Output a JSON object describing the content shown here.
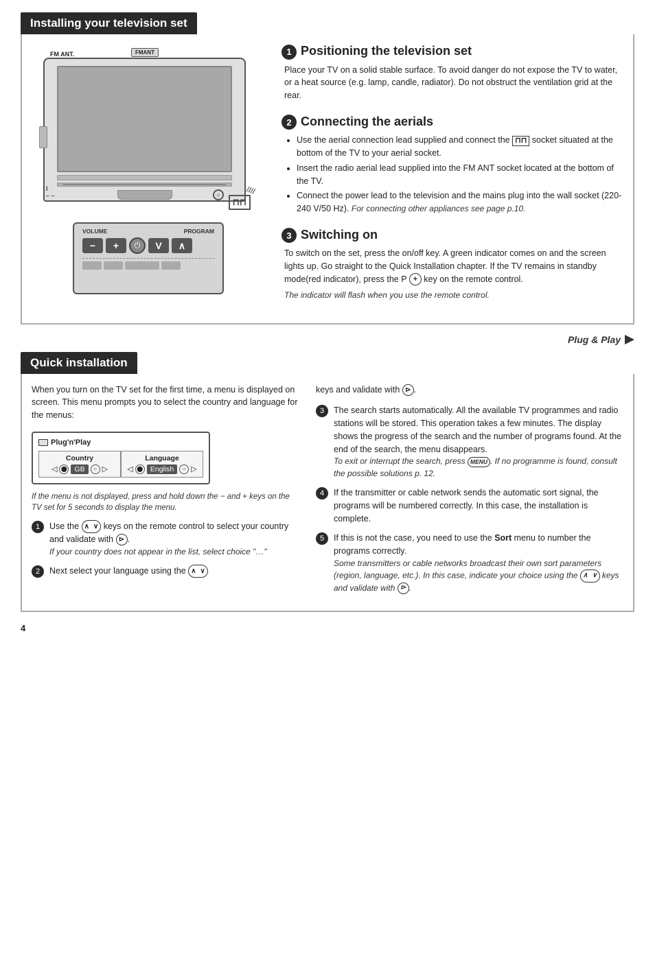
{
  "page": {
    "number": "4"
  },
  "top_section": {
    "header": "Installing your television set",
    "steps": [
      {
        "number": "❶",
        "title": "Positioning the television set",
        "body": "Place your TV on a solid stable surface.  To avoid danger do not expose the TV to water, or a heat source (e.g. lamp, candle, radiator).  Do not obstruct the ventilation grid at the rear."
      },
      {
        "number": "❷",
        "title": "Connecting the aerials",
        "bullets": [
          "Use the aerial connection lead supplied and connect the socket situated at the bottom of the TV to your aerial socket.",
          "Insert the radio aerial lead supplied into the FM ANT socket located at the bottom of the TV.",
          "Connect the power lead to the television and the mains plug into the wall socket (220-240 V/50 Hz)."
        ],
        "note": "For connecting other appliances see page p.10."
      },
      {
        "number": "❸",
        "title": "Switching on",
        "body": "To switch on the set, press the on/off key.  A green indicator comes on and the screen lights up.  Go straight to the Quick Installation chapter. If the TV remains in standby mode(red indicator), press the P key on the remote control.",
        "italic": "The indicator will flash when you use the remote control."
      }
    ],
    "remote_labels": {
      "volume": "VOLUME",
      "program": "PROGRAM",
      "minus": "−",
      "plus": "+",
      "v_down": "V",
      "v_up": "∧",
      "fm_ant": "FM ANT.",
      "fm_ant_socket": "FMANT"
    }
  },
  "plug_play": {
    "label": "Plug & Play"
  },
  "bottom_section": {
    "header": "Quick installation",
    "intro": "When you turn on the TV set for the first time, a menu is displayed on screen. This menu prompts you to select the country and language for the menus:",
    "menu_box": {
      "title": "Plug'n'Play",
      "country_header": "Country",
      "language_header": "Language",
      "country_value": "GB",
      "language_value": "English"
    },
    "menu_note": "If the menu is not displayed, press and hold down the  −  and  + keys on the TV set for 5 seconds to display the menu.",
    "steps_left": [
      {
        "number": "❶",
        "text": "Use the keys on the remote control to select your country and validate with .",
        "italic": "If your country does not appear in the list, select choice \"…\""
      },
      {
        "number": "❷",
        "text": "Next select your language using the"
      }
    ],
    "keys_and_validate": "keys and validate with .",
    "steps_right": [
      {
        "number": "❸",
        "text": "The search starts automatically. All the available TV programmes and radio stations will be stored. This operation takes a few minutes. The display shows the progress of the search and the number of programs found.  At the end of the search, the menu disappears.",
        "italic": "To exit or interrupt the search, press MENU. If no programme is found, consult the possible solutions p. 12."
      },
      {
        "number": "❹",
        "text": "If the transmitter or cable network sends the automatic sort signal, the programs will be numbered correctly. In this case, the installation is complete."
      },
      {
        "number": "❺",
        "text": "If this is not the case, you need to use the Sort menu to number the programs correctly.",
        "italic": "Some transmitters or cable networks broadcast their own sort parameters (region, language, etc.). In this case, indicate your choice using the keys and validate with ."
      }
    ]
  }
}
